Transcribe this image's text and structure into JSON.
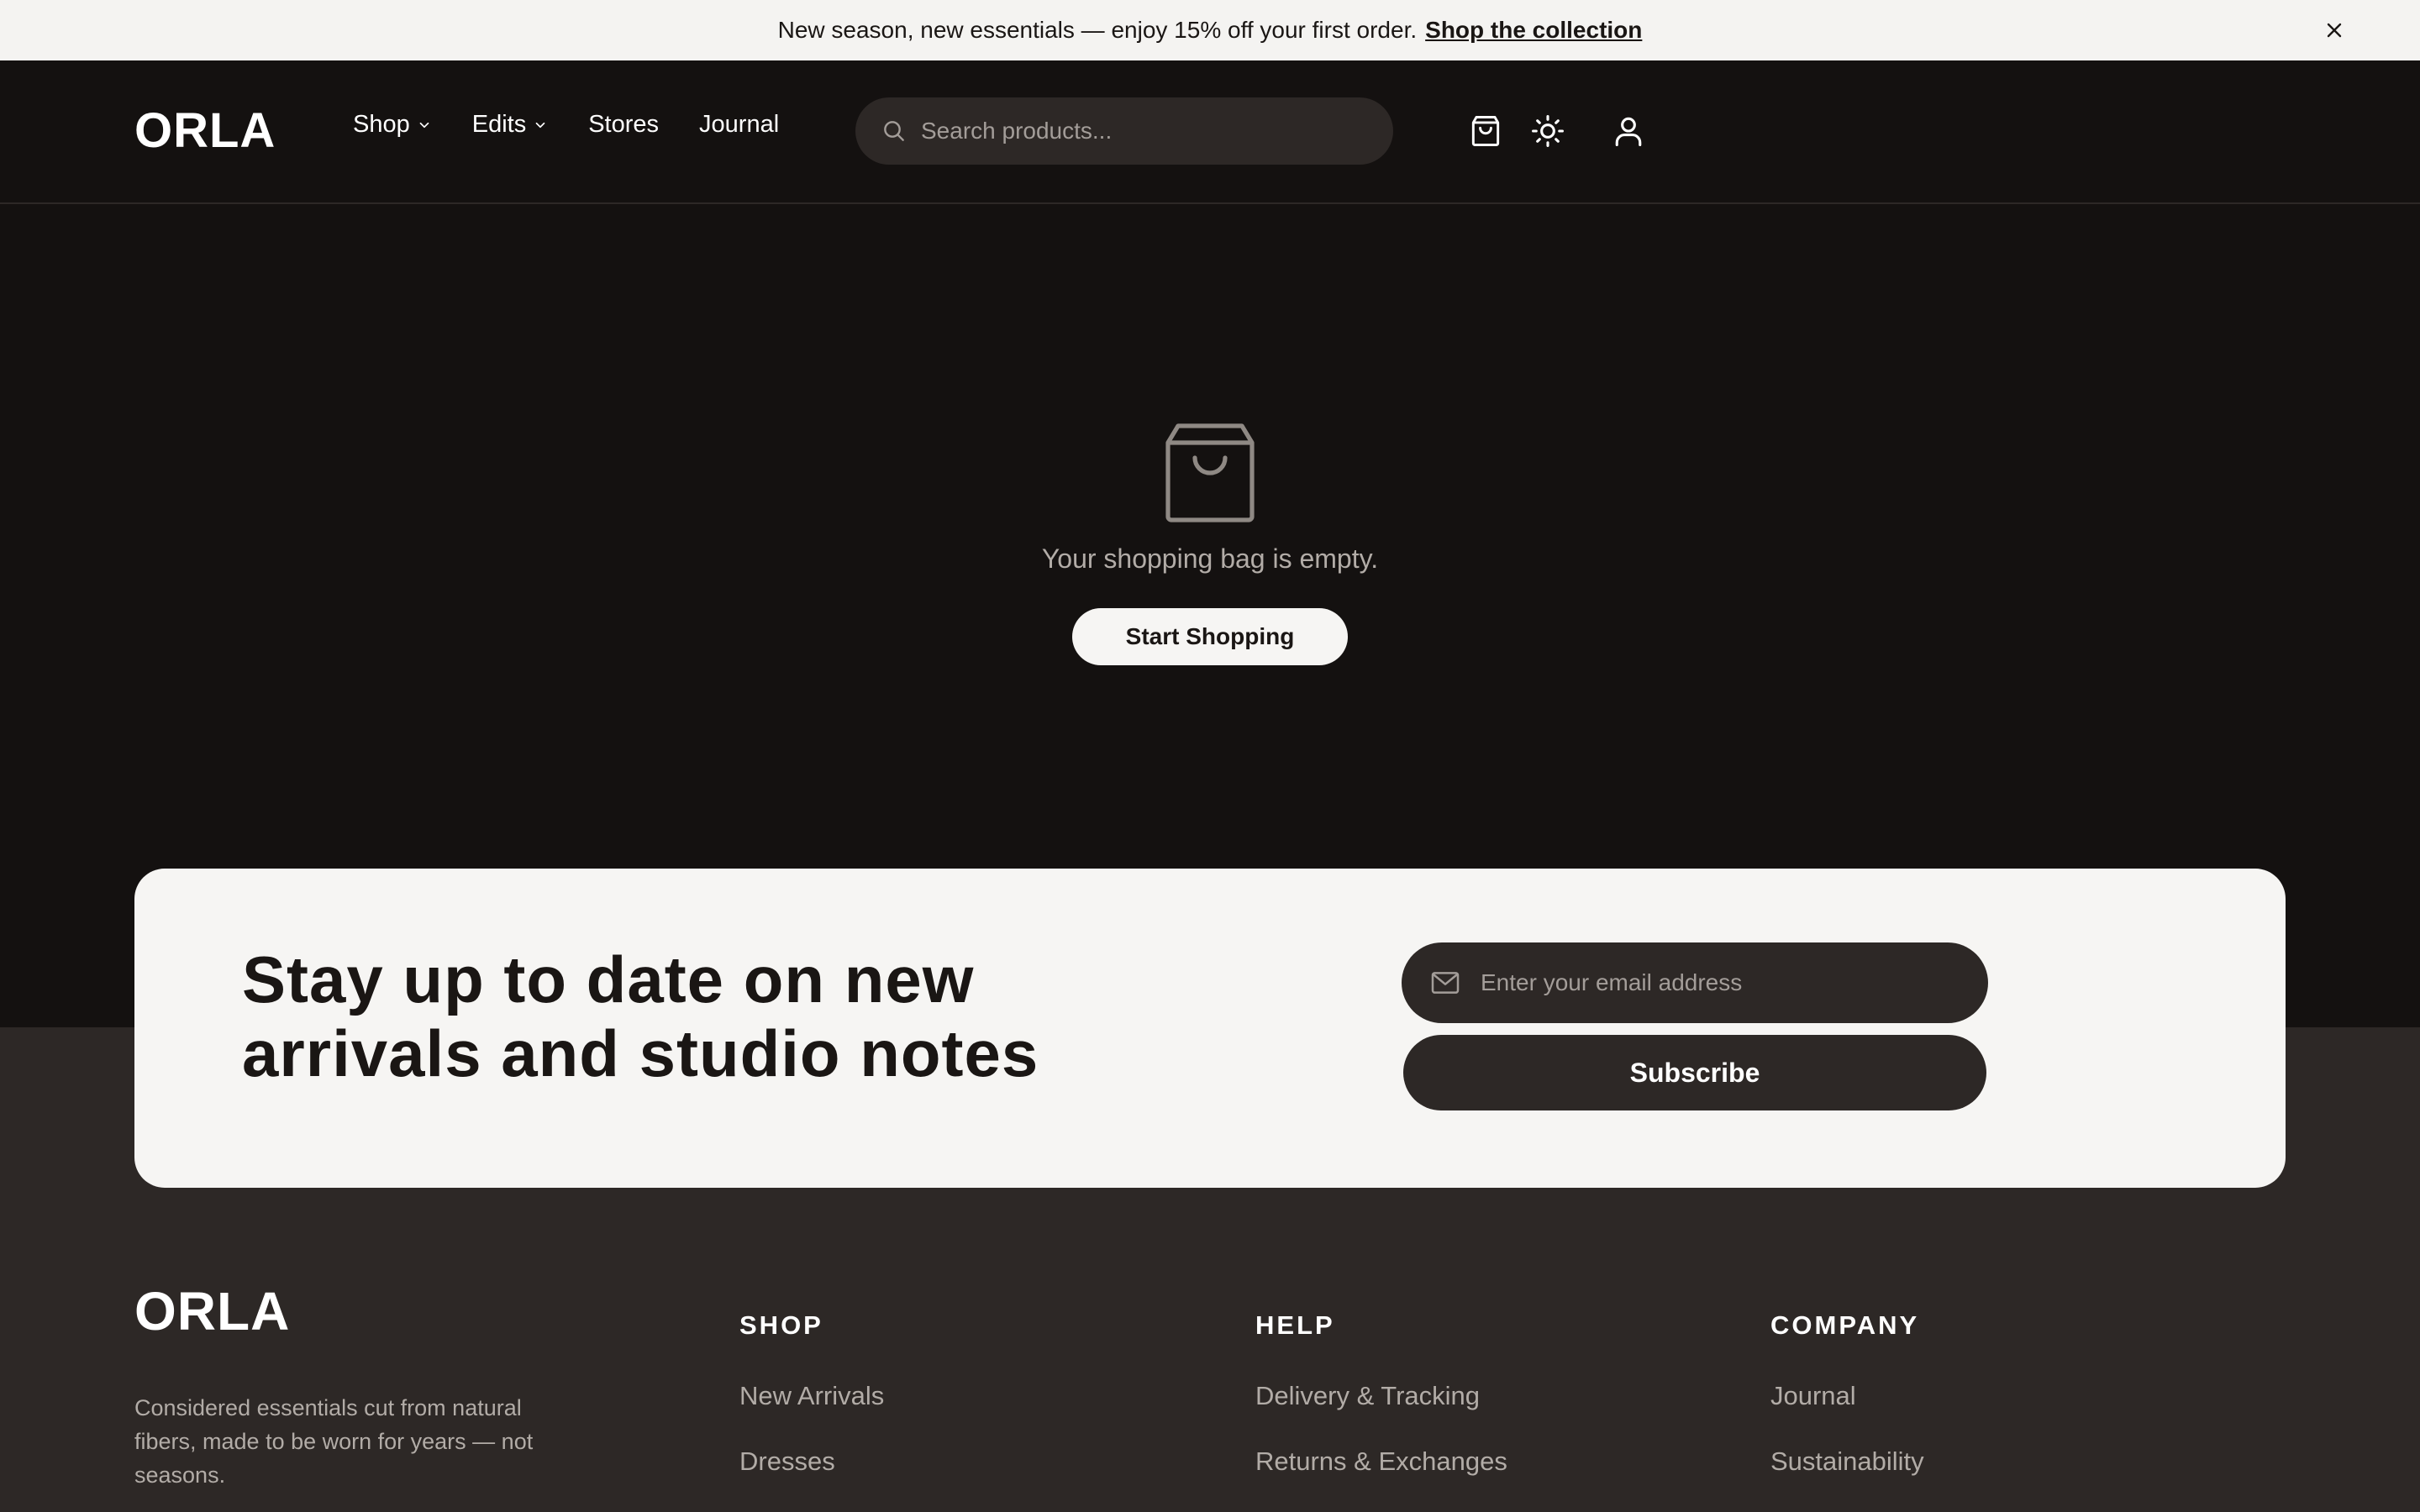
{
  "announcement": {
    "text": "New season, new essentials — enjoy 15% off your first order.",
    "link": "Shop the collection",
    "close_icon": "close-icon"
  },
  "header": {
    "logo": "ORLA",
    "nav": [
      {
        "label": "Shop",
        "dropdown": true
      },
      {
        "label": "Edits",
        "dropdown": true
      },
      {
        "label": "Stores",
        "dropdown": false
      },
      {
        "label": "Journal",
        "dropdown": false
      }
    ],
    "search_placeholder": "Search products...",
    "icons": [
      "shopping-bag-icon",
      "sun-icon",
      "user-icon"
    ]
  },
  "empty_bag": {
    "icon": "shopping-bag-icon",
    "message": "Your shopping bag is empty.",
    "button": "Start Shopping"
  },
  "newsletter": {
    "title_line1": "Stay up to date on new",
    "title_line2": "arrivals and studio notes",
    "email_placeholder": "Enter your email address",
    "button": "Subscribe"
  },
  "footer": {
    "logo": "ORLA",
    "description": "Considered essentials cut from natural fibers, made to be worn for years — not seasons.",
    "columns": [
      {
        "heading": "SHOP",
        "links": [
          "New Arrivals",
          "Dresses"
        ]
      },
      {
        "heading": "HELP",
        "links": [
          "Delivery & Tracking",
          "Returns & Exchanges"
        ]
      },
      {
        "heading": "COMPANY",
        "links": [
          "Journal",
          "Sustainability"
        ]
      }
    ]
  },
  "colors": {
    "background_dark": "#141110",
    "background_footer": "#2d2826",
    "card_light": "#f6f5f3",
    "text_muted": "#b2aca7"
  }
}
